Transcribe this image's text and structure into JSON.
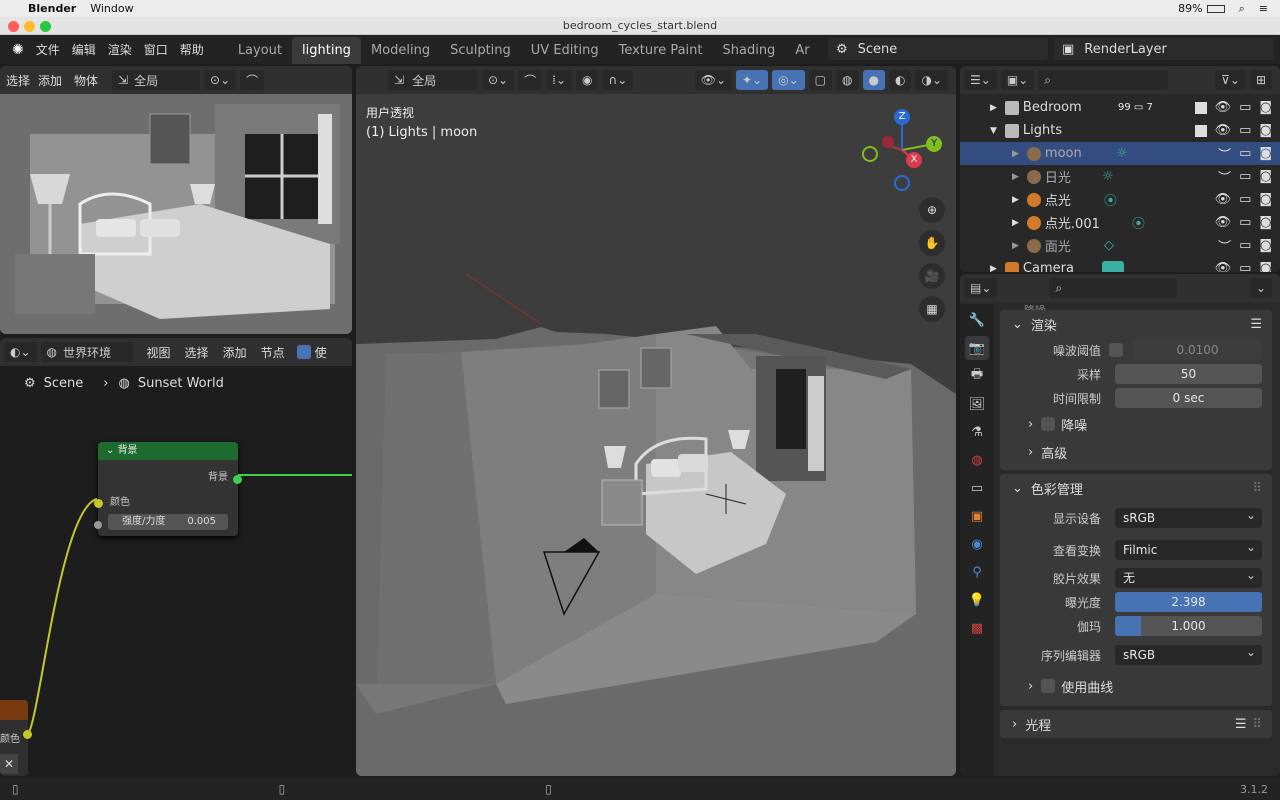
{
  "mac_menu": {
    "apple": "",
    "app": "Blender",
    "window": "Window",
    "battery": "89%"
  },
  "window_title": "bedroom_cycles_start.blend",
  "menus": [
    "文件",
    "编辑",
    "渲染",
    "窗口",
    "帮助"
  ],
  "workspaces": [
    "Layout",
    "lighting",
    "Modeling",
    "Sculpting",
    "UV Editing",
    "Texture Paint",
    "Shading",
    "Ar"
  ],
  "scene": {
    "label": "Scene",
    "renderlayer": "RenderLayer"
  },
  "left_viewport": {
    "select": "选择",
    "add": "添加",
    "object": "物体",
    "orient": "全局"
  },
  "node_editor": {
    "world_env": "世界环境",
    "view": "视图",
    "select": "选择",
    "add": "添加",
    "node": "节点",
    "use": "使",
    "breadcrumb_scene": "Scene",
    "breadcrumb_world": "Sunset World",
    "node_title": "背景",
    "node_out": "背景",
    "node_color": "颜色",
    "node_strength": "强度/力度",
    "node_strength_val": "0.005",
    "left_socket_label": "颜色"
  },
  "viewport": {
    "orient": "全局",
    "title": "用户透视",
    "subtitle": "(1) Lights | moon"
  },
  "gizmo": {
    "z": "Z",
    "y": "Y",
    "x": "X"
  },
  "outliner": {
    "rows": [
      {
        "name": "Bedroom",
        "badge": "99",
        "badge2": "7"
      },
      {
        "name": "Lights"
      },
      {
        "name": "moon"
      },
      {
        "name": "日光"
      },
      {
        "name": "点光"
      },
      {
        "name": "点光.001"
      },
      {
        "name": "面光"
      },
      {
        "name": "Camera"
      }
    ]
  },
  "properties": {
    "top_cut": "降噪",
    "render_header": "渲染",
    "noise_threshold_label": "噪波阈值",
    "noise_threshold": "0.0100",
    "samples_label": "采样",
    "samples": "50",
    "timelimit_label": "时间限制",
    "timelimit": "0 sec",
    "denoise": "降噪",
    "advanced": "高级",
    "color_mgmt": "色彩管理",
    "display_label": "显示设备",
    "display": "sRGB",
    "view_label": "查看变换",
    "view": "Filmic",
    "look_label": "胶片效果",
    "look": "无",
    "exposure_label": "曝光度",
    "exposure": "2.398",
    "exposure_fill": 0.08,
    "gamma_label": "伽玛",
    "gamma": "1.000",
    "gamma_fill": 0.18,
    "seq_label": "序列编辑器",
    "seq": "sRGB",
    "curves": "使用曲线",
    "lightpaths": "光程"
  },
  "status": {
    "version": "3.1.2"
  }
}
